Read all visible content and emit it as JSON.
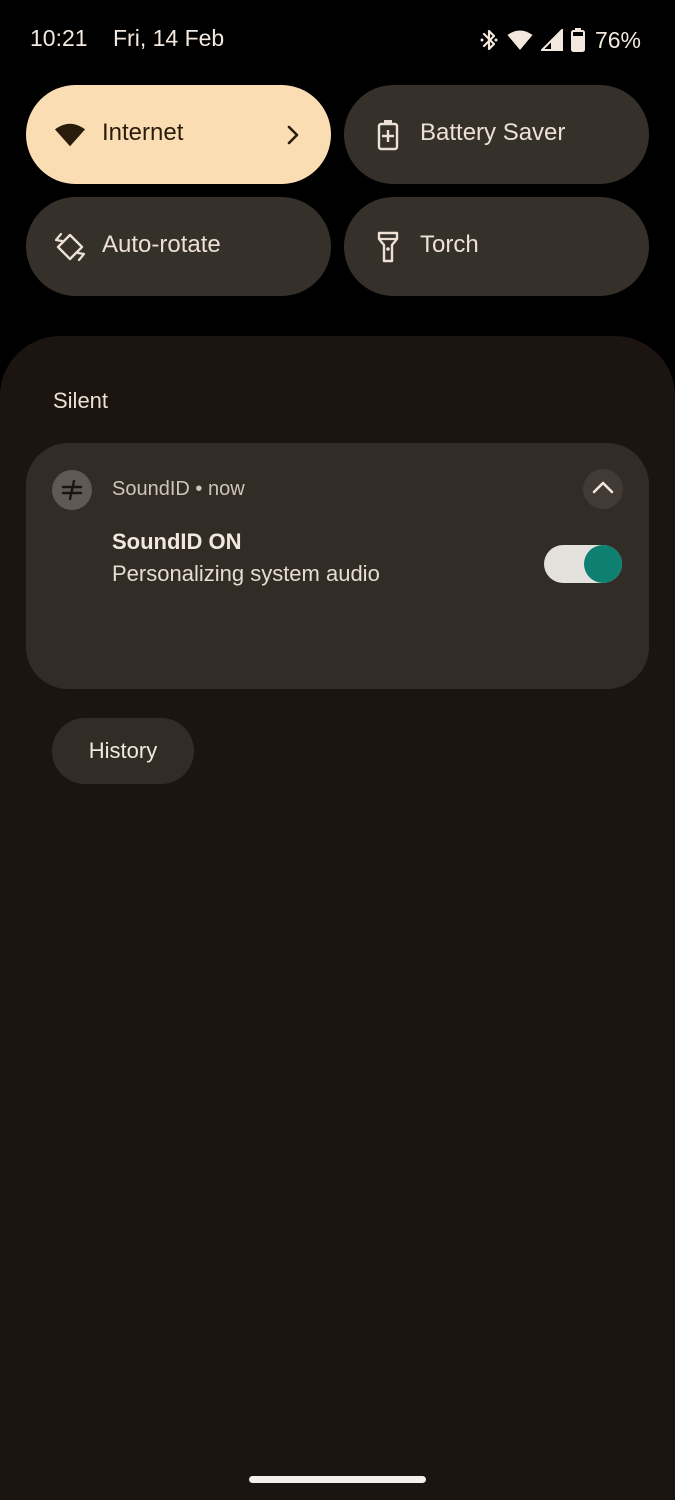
{
  "status_bar": {
    "time": "10:21",
    "date": "Fri, 14 Feb",
    "battery_percent": "76%",
    "icons": [
      "bluetooth-icon",
      "wifi-icon",
      "signal-icon",
      "battery-icon"
    ]
  },
  "quick_tiles": [
    {
      "label": "Internet",
      "icon": "wifi-icon",
      "active": true,
      "has_chevron": true
    },
    {
      "label": "Battery Saver",
      "icon": "battery-saver-icon",
      "active": false
    },
    {
      "label": "Auto-rotate",
      "icon": "rotate-icon",
      "active": false
    },
    {
      "label": "Torch",
      "icon": "torch-icon",
      "active": false
    }
  ],
  "notifications": {
    "section_label": "Silent",
    "items": [
      {
        "app_name": "SoundID",
        "time": "now",
        "meta": "SoundID • now",
        "title": "SoundID ON",
        "text": "Personalizing system audio",
        "toggle_on": true
      }
    ],
    "history_label": "History"
  },
  "colors": {
    "active_tile": "#FBDDB4",
    "inactive_tile": "#36302A",
    "shade_bg": "#1B1410",
    "card_bg": "#322C27",
    "toggle_knob": "#0E8071"
  }
}
